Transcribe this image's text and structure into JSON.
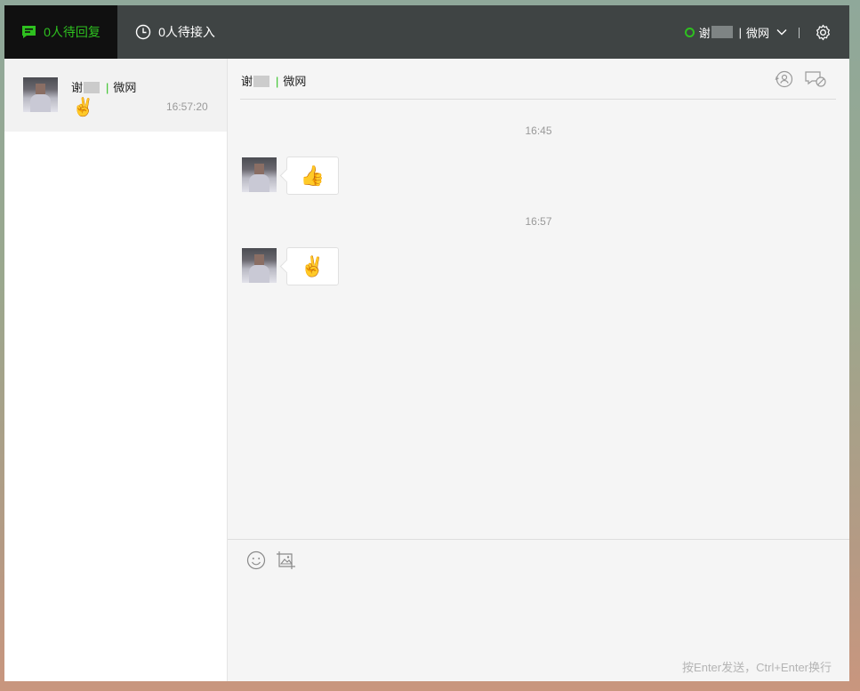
{
  "topbar": {
    "tab_reply": "0人待回复",
    "tab_pending": "0人待接入",
    "agent_name_prefix": "谢",
    "agent_org": "微网",
    "status_color": "#2ec01f"
  },
  "sidebar": {
    "conversations": [
      {
        "name_prefix": "谢",
        "name_suffix": "",
        "org": "微网",
        "last_message": "✌️",
        "time": "16:57:20"
      }
    ]
  },
  "chat": {
    "title_prefix": "谢",
    "title_org": "微网",
    "messages": [
      {
        "timestamp": "16:45",
        "content": "👍"
      },
      {
        "timestamp": "16:57",
        "content": "✌️"
      }
    ]
  },
  "composer": {
    "hint": "按Enter发送，Ctrl+Enter换行"
  }
}
